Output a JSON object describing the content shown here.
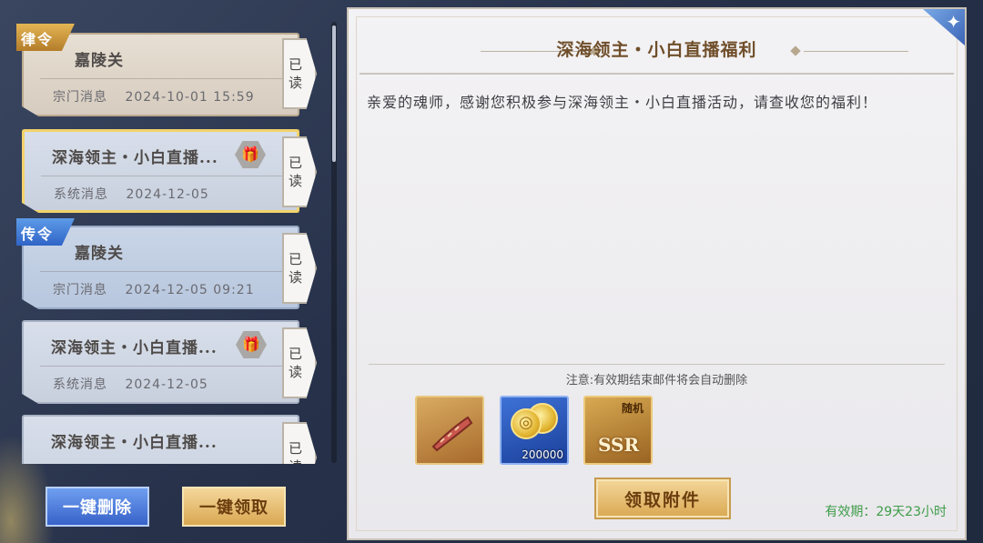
{
  "mail_list": [
    {
      "badge": "律令",
      "badge_color": "#c99338",
      "title": "嘉陵关",
      "category": "宗门消息",
      "timestamp": "2024-10-01 15:59",
      "status": [
        "已",
        "读"
      ],
      "has_gift": false,
      "style": "sect"
    },
    {
      "badge": "",
      "title": "深海领主・小白直播...",
      "category": "系统消息",
      "timestamp": "2024-12-05",
      "status": [
        "已",
        "读"
      ],
      "has_gift": true,
      "gift_icon": "gift-icon",
      "style": "selected"
    },
    {
      "badge": "传令",
      "badge_color": "#3a74d6",
      "title": "嘉陵关",
      "category": "宗门消息",
      "timestamp": "2024-12-05 09:21",
      "status": [
        "已",
        "读"
      ],
      "has_gift": false,
      "style": "blue"
    },
    {
      "badge": "",
      "title": "深海领主・小白直播...",
      "category": "系统消息",
      "timestamp": "2024-12-05",
      "status": [
        "已",
        "读"
      ],
      "has_gift": true,
      "gift_icon": "gift-icon",
      "style": "sys"
    },
    {
      "badge": "",
      "title": "深海领主・小白直播...",
      "category": "",
      "timestamp": "",
      "status": [
        "已",
        "读"
      ],
      "has_gift": false,
      "style": "sys"
    }
  ],
  "buttons": {
    "delete_all": "一键删除",
    "claim_all": "一键领取",
    "claim_attachment": "领取附件"
  },
  "mail_detail": {
    "title": "深海领主・小白直播福利",
    "body": "亲爱的魂师，感谢您积极参与深海领主・小白直播活动，请查收您的福利！",
    "notice": "注意:有效期结束邮件将会自动删除",
    "validity": "有效期：29天23小时",
    "attachments": [
      {
        "icon": "sausage-icon",
        "quantity": "",
        "label": ""
      },
      {
        "icon": "gold-coin-icon",
        "quantity": "200000",
        "label": ""
      },
      {
        "icon": "ssr-icon",
        "quantity": "",
        "label": "随机",
        "text": "SSR"
      }
    ]
  },
  "colors": {
    "accent_gold": "#d9a852",
    "accent_blue": "#3862c9",
    "title_brown": "#6f4e2a",
    "validity_green": "#3d9c48"
  }
}
